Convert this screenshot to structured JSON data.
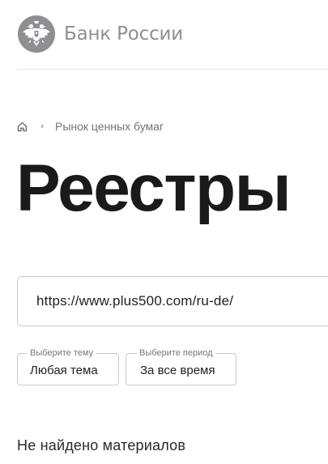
{
  "header": {
    "bank_name": "Банк России",
    "logo_icon": "double-headed-eagle-emblem"
  },
  "breadcrumb": {
    "home_icon": "home-icon",
    "separator_icon": "chevron-right-icon",
    "section": "Рынок ценных бумаг"
  },
  "page": {
    "title": "Реестры"
  },
  "search": {
    "value": "https://www.plus500.com/ru-de/"
  },
  "filters": {
    "theme": {
      "legend": "Выберите тему",
      "value": "Любая тема"
    },
    "period": {
      "legend": "Выберите период",
      "value": "За все время"
    }
  },
  "results": {
    "empty_message": "Не найдено материалов"
  },
  "colors": {
    "logo_gray": "#8e8f93",
    "text": "#1f1f1f",
    "muted": "#717378",
    "border": "#c9cacd",
    "divider": "#e3e3e5"
  }
}
